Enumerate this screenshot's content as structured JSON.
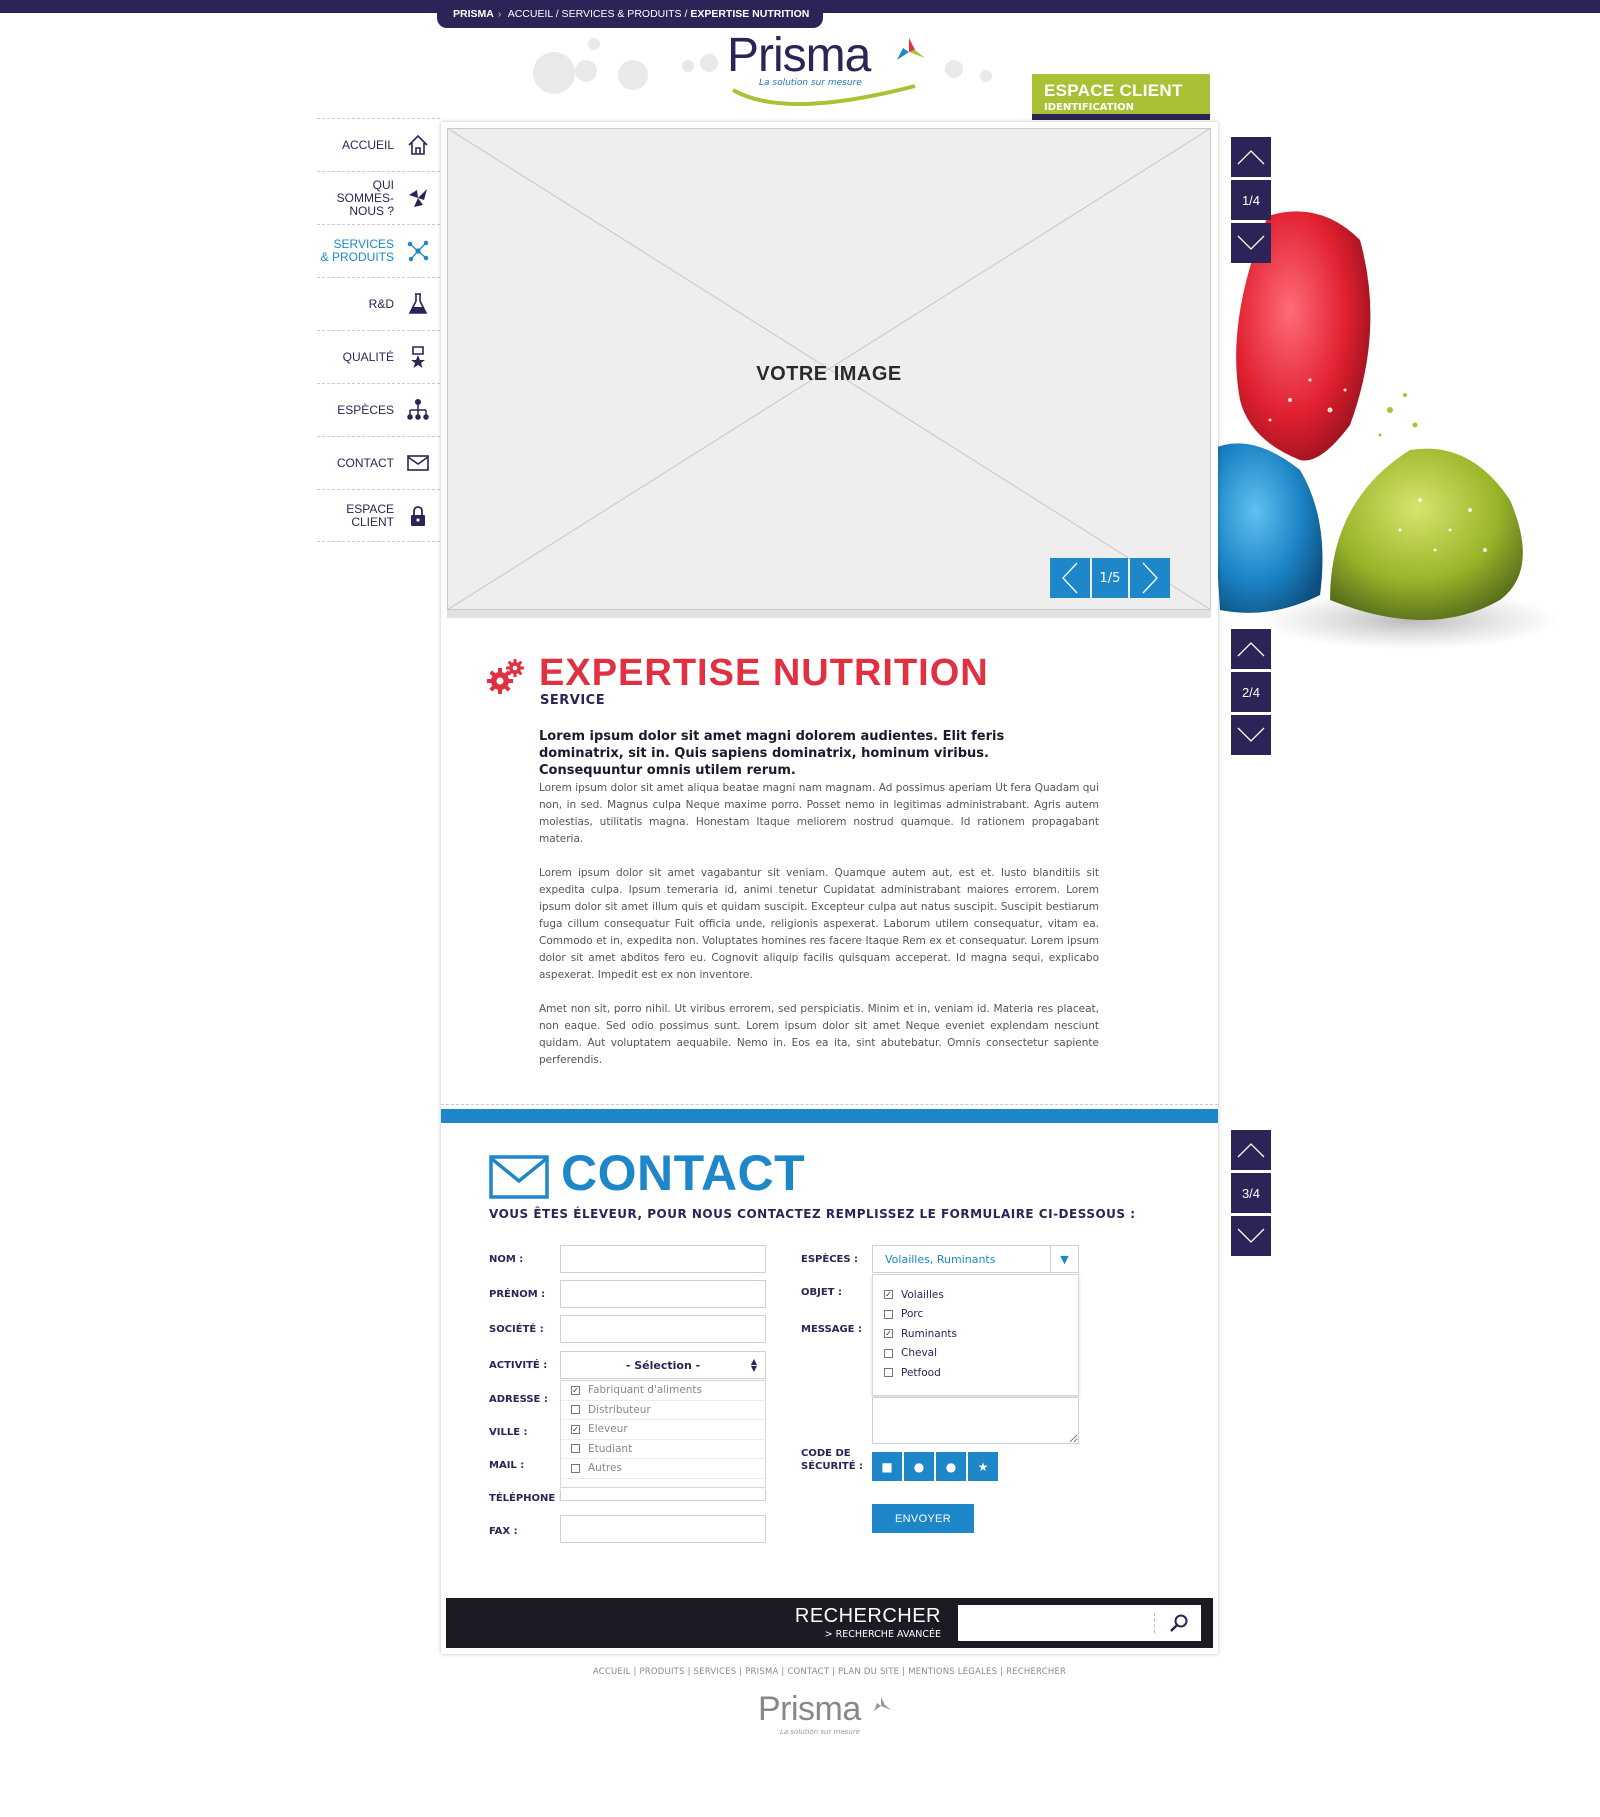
{
  "breadcrumb": {
    "site": "PRISMA",
    "path": "ACCUEIL / SERVICES & PRODUITS /",
    "current": "EXPERTISE NUTRITION"
  },
  "logo": {
    "name": "Prisma",
    "tagline": "La solution sur mesure"
  },
  "espace_client": {
    "title": "ESPACE CLIENT",
    "subtitle": "IDENTIFICATION"
  },
  "nav": [
    {
      "label": "ACCUEIL",
      "icon": "home-icon",
      "active": false
    },
    {
      "label": "QUI\nSOMMES-NOUS ?",
      "icon": "tri-leaf-icon",
      "active": false
    },
    {
      "label": "SERVICES\n& PRODUITS",
      "icon": "molecule-icon",
      "active": true
    },
    {
      "label": "R&D",
      "icon": "flask-icon",
      "active": false
    },
    {
      "label": "QUALITÉ",
      "icon": "award-icon",
      "active": false
    },
    {
      "label": "ESPÈCES",
      "icon": "hierarchy-icon",
      "active": false
    },
    {
      "label": "CONTACT",
      "icon": "envelope-icon",
      "active": false
    },
    {
      "label": "ESPACE\nCLIENT",
      "icon": "lock-icon",
      "active": false
    }
  ],
  "slider": {
    "placeholder": "VOTRE IMAGE",
    "counter": "1/5"
  },
  "article": {
    "title": "EXPERTISE NUTRITION",
    "subtitle": "SERVICE",
    "lead": "Lorem ipsum dolor sit amet magni dolorem audientes. Elit feris dominatrix, sit in. Quis sapiens dominatrix, hominum viribus. Consequuntur omnis utilem rerum.",
    "paragraphs": [
      "Lorem ipsum dolor sit amet aliqua beatae magni nam magnam. Ad possimus aperiam Ut fera Quadam qui non, in sed. Magnus culpa Neque maxime porro. Posset nemo in legitimas administrabant. Agris autem molestias, utilitatis magna. Honestam Itaque meliorem nostrud quamque. Id rationem propagabant materia.",
      "Lorem ipsum dolor sit amet vagabantur sit veniam. Quamque autem aut, est et. Iusto blanditiis sit expedita culpa. Ipsum temeraria id, animi tenetur Cupidatat administrabant maiores errorem. Lorem ipsum dolor sit amet illum quis et quidam suscipit. Excepteur culpa aut natus suscipit. Suscipit bestiarum fuga cillum consequatur Fuit officia unde, religionis aspexerat. Laborum utilem consequatur, vitam ea. Commodo et in, expedita non. Voluptates homines res facere Itaque Rem ex et consequatur. Lorem ipsum dolor sit amet abditos fero eu. Cognovit aliquip facilis quisquam acceperat. Id magna sequi, explicabo aspexerat. Impedit est ex non inventore.",
      "Amet non sit, porro nihil. Ut viribus errorem, sed perspiciatis. Minim et in, veniam id. Materia res placeat, non eaque. Sed odio possimus sunt. Lorem ipsum dolor sit amet Neque eveniet explendam nesciunt quidam. Aut voluptatem aequabile. Nemo in. Eos ea ita, sint abutebatur. Omnis consectetur sapiente perferendis."
    ]
  },
  "contact": {
    "title": "CONTACT",
    "subtitle": "VOUS ÊTES ÉLEVEUR, POUR NOUS CONTACTEZ REMPLISSEZ LE FORMULAIRE CI-DESSOUS :",
    "labels": {
      "nom": "NOM :",
      "prenom": "PRÉNOM :",
      "societe": "SOCIÉTÉ :",
      "activite": "ACTIVITÉ :",
      "adresse": "ADRESSE :",
      "ville": "VILLE :",
      "mail": "MAIL :",
      "telephone": "TÉLÉPHONE :",
      "fax": "FAX :",
      "especes": "ESPÈCES :",
      "objet": "OBJET :",
      "message": "MESSAGE :",
      "code": "CODE DE\nSÉCURITÉ :"
    },
    "activite_select": "- Sélection -",
    "activite_options": [
      {
        "label": "Fabriquant d'aliments",
        "checked": true
      },
      {
        "label": "Distributeur",
        "checked": false
      },
      {
        "label": "Eleveur",
        "checked": true
      },
      {
        "label": "Etudiant",
        "checked": false
      },
      {
        "label": "Autres",
        "checked": false
      }
    ],
    "especes_select": "Volailles, Ruminants",
    "especes_options": [
      {
        "label": "Volailles",
        "checked": true
      },
      {
        "label": "Porc",
        "checked": false
      },
      {
        "label": "Ruminants",
        "checked": true
      },
      {
        "label": "Cheval",
        "checked": false
      },
      {
        "label": "Petfood",
        "checked": false
      }
    ],
    "code_glyphs": [
      "■",
      "●",
      "●",
      "★"
    ],
    "send_label": "ENVOYER"
  },
  "search": {
    "title": "RECHERCHER",
    "advanced": "> RECHERCHE AVANCÉE",
    "placeholder": ""
  },
  "pagers": [
    {
      "label": "1/4"
    },
    {
      "label": "2/4"
    },
    {
      "label": "3/4"
    }
  ],
  "footer": {
    "links": "ACCUEIL | PRODUITS | SERVICES | PRISMA | CONTACT | PLAN DU SITE | MENTIONS LÉGALES | RECHERCHER",
    "logo": "Prisma",
    "tagline": "La solution sur mesure"
  },
  "colors": {
    "navy": "#2c2457",
    "blue": "#1d87c9",
    "red": "#e13141",
    "green": "#a9c235"
  }
}
